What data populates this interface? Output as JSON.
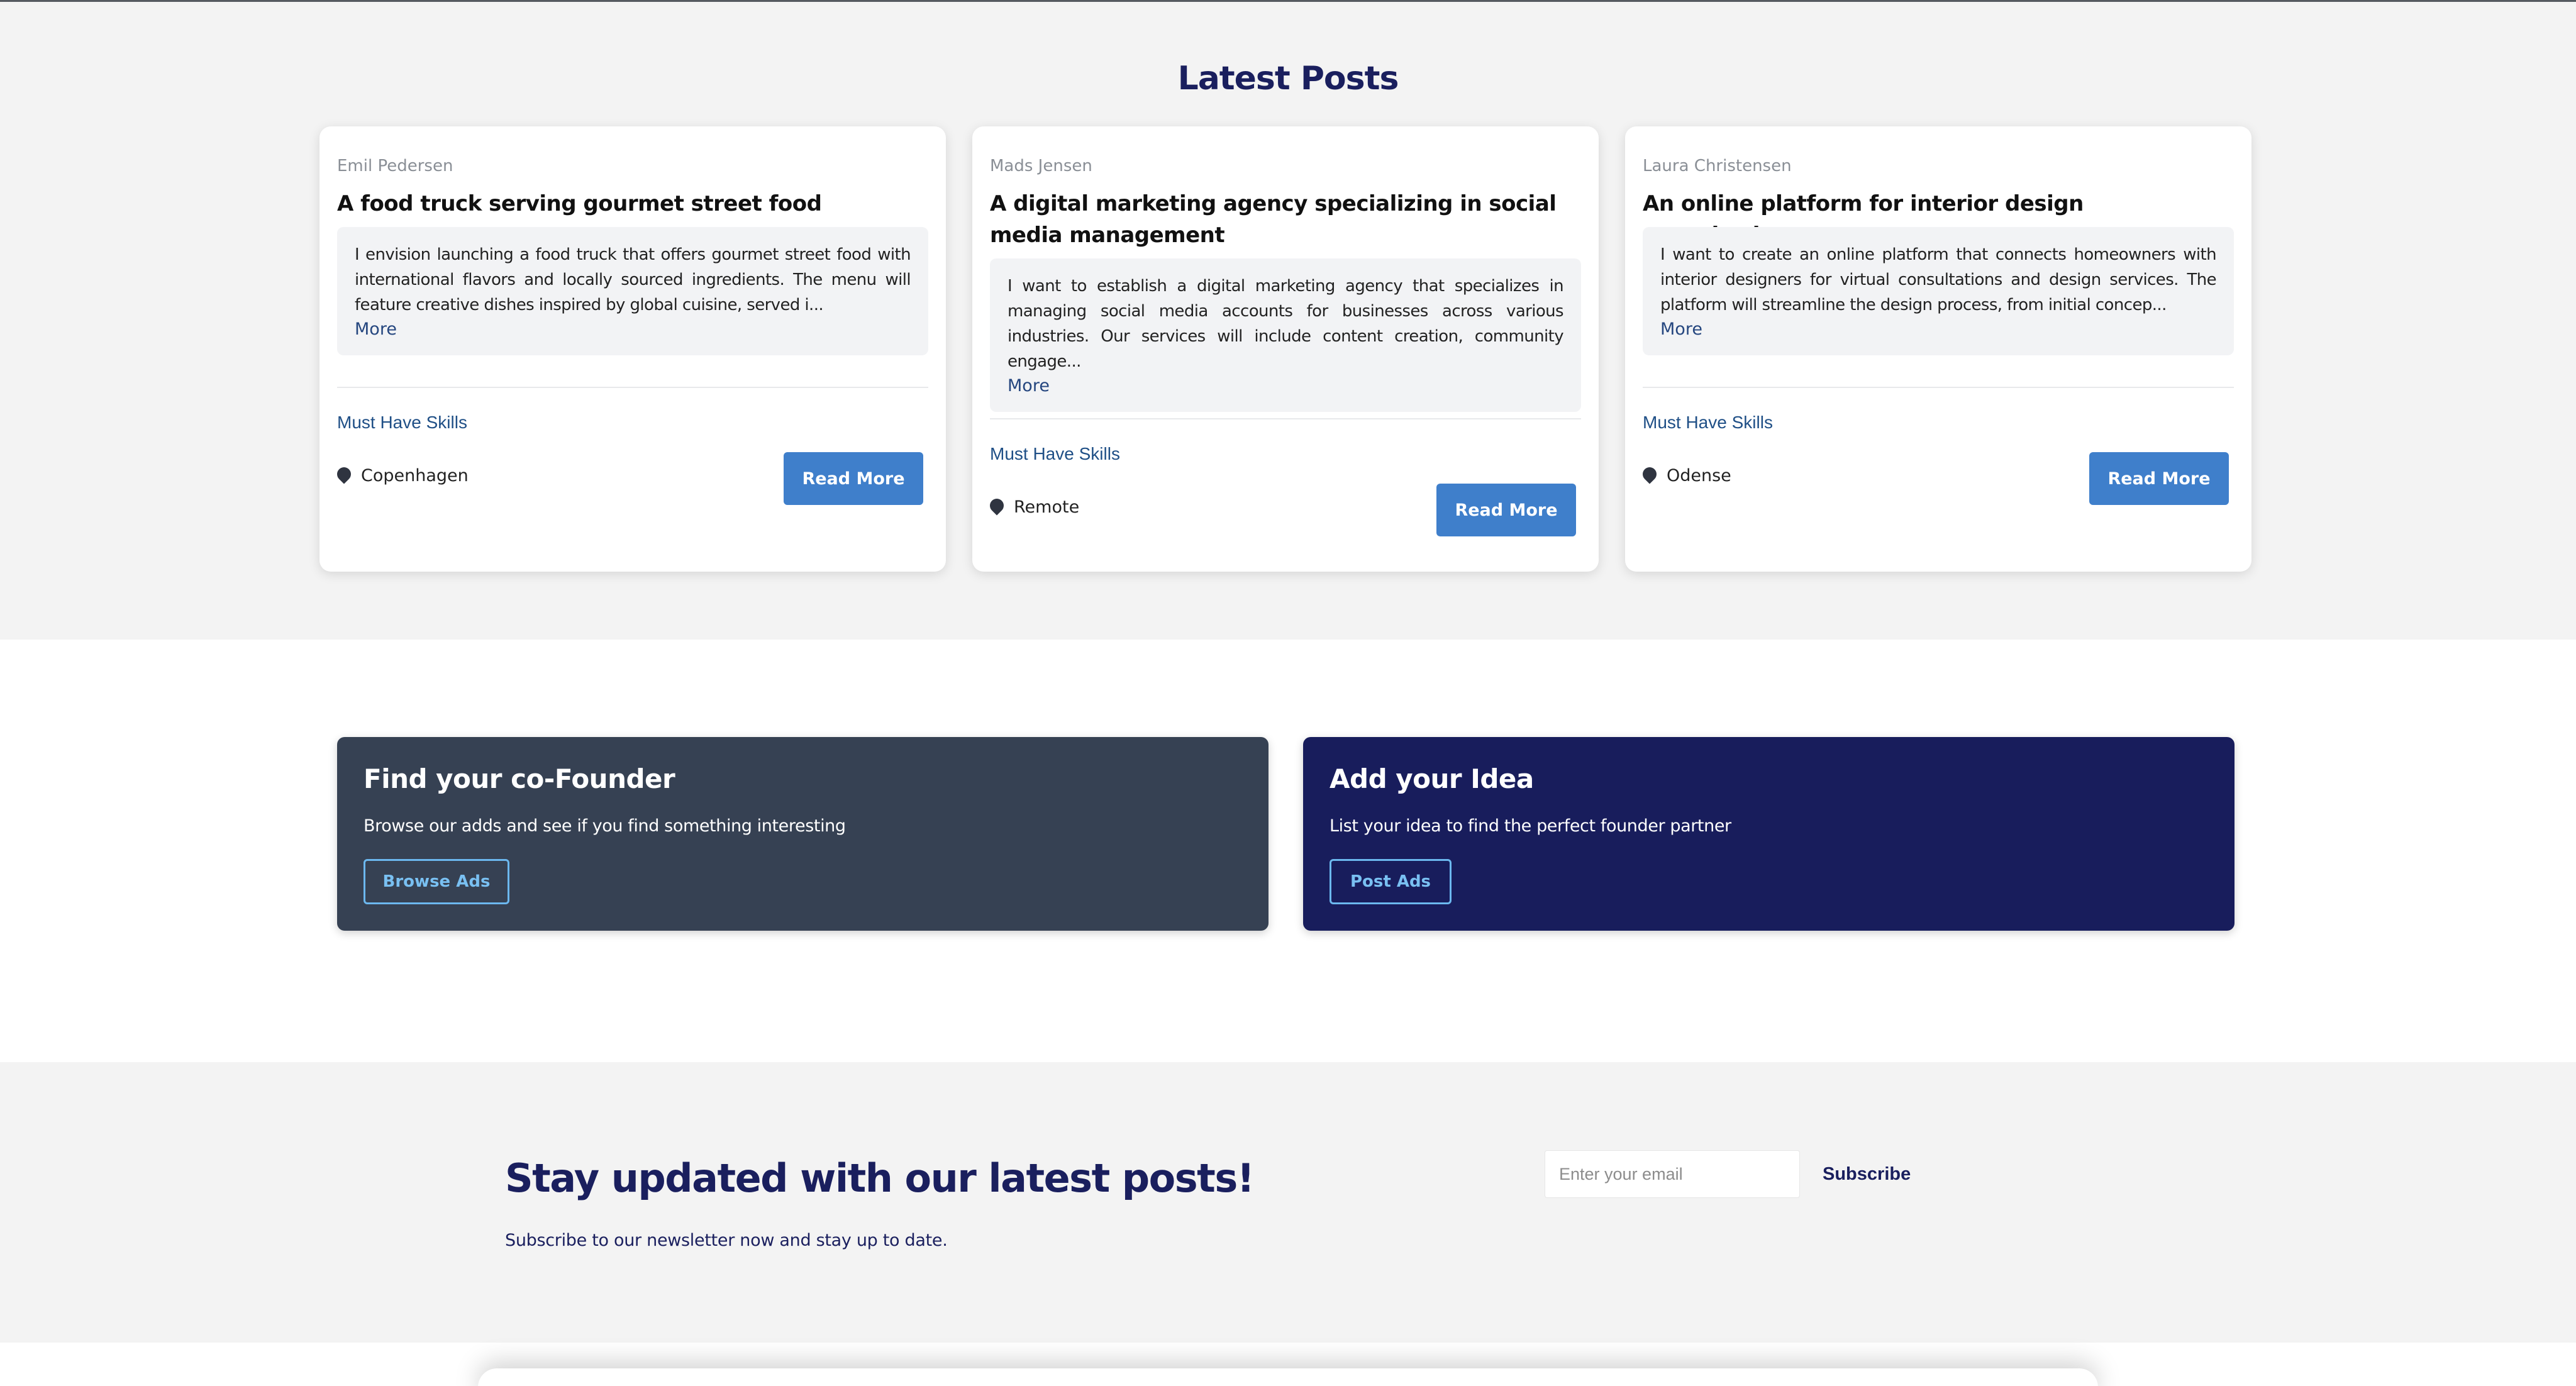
{
  "latest_posts": {
    "title": "Latest Posts",
    "posts": [
      {
        "author": "Emil Pedersen",
        "title": "A food truck serving gourmet street food",
        "description": "I envision launching a food truck that offers gourmet street food with international flavors and locally sourced ingredients. The menu will feature creative dishes inspired by global cuisine, served i...",
        "more_label": "More",
        "skills_label": "Must Have Skills",
        "location": "Copenhagen",
        "button_label": "Read More"
      },
      {
        "author": "Mads Jensen",
        "title": "A digital marketing agency specializing in social media management",
        "description": "I want to establish a digital marketing agency that specializes in managing social media accounts for businesses across various industries. Our services will include content creation, community engage...",
        "more_label": "More",
        "skills_label": "Must Have Skills",
        "location": "Remote",
        "button_label": "Read More"
      },
      {
        "author": "Laura Christensen",
        "title": "An online platform for interior design consultations",
        "description": "I want to create an online platform that connects homeowners with interior designers for virtual consultations and design services. The platform will streamline the design process, from initial concep...",
        "more_label": "More",
        "skills_label": "Must Have Skills",
        "location": "Odense",
        "button_label": "Read More"
      }
    ]
  },
  "features": {
    "cofounder": {
      "title": "Find your co-Founder",
      "text": "Browse our adds and see if you find something interesting",
      "button_label": "Browse Ads",
      "background": "#364153"
    },
    "idea": {
      "title": "Add your Idea",
      "text": "List your idea to find the perfect founder partner",
      "button_label": "Post Ads",
      "background": "#181d5c"
    }
  },
  "newsletter": {
    "title": "Stay updated with our latest posts!",
    "subtitle": "Subscribe to our newsletter now and stay up to date.",
    "email_placeholder": "Enter your email",
    "button_label": "Subscribe"
  },
  "colors": {
    "accent": "#3f7fcb",
    "heading": "#1a1f5e",
    "link": "#1f4f86"
  },
  "icons": {
    "location": "map-pin-icon"
  }
}
